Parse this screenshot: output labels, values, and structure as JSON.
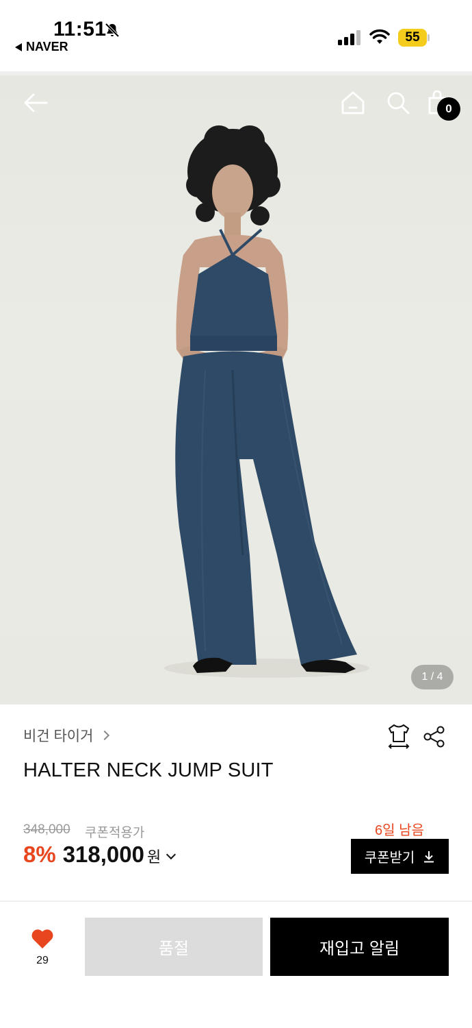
{
  "status_bar": {
    "time": "11:51",
    "back_app": "NAVER",
    "battery": "55",
    "icons": [
      "bell-muted-icon",
      "signal-icon",
      "wifi-icon",
      "battery-icon"
    ]
  },
  "header": {
    "icons": [
      "back-arrow-icon",
      "home-icon",
      "search-icon",
      "shopping-bag-icon"
    ],
    "cart_count": "0"
  },
  "gallery": {
    "pager": "1 / 4"
  },
  "product": {
    "brand": "비건 타이거",
    "title": "HALTER NECK JUMP SUIT",
    "original_price": "348,000",
    "coupon_label": "쿠폰적용가",
    "discount": "8%",
    "price": "318,000",
    "currency": "원"
  },
  "coupon": {
    "days_left": "6일 남음",
    "button_label": "쿠폰받기"
  },
  "actions": {
    "like_count": "29",
    "soldout_label": "품절",
    "restock_label": "재입고 알림"
  },
  "colors": {
    "accent": "#e8461e",
    "battery": "#f4cc1c",
    "jumpsuit": "#2f4a66"
  }
}
